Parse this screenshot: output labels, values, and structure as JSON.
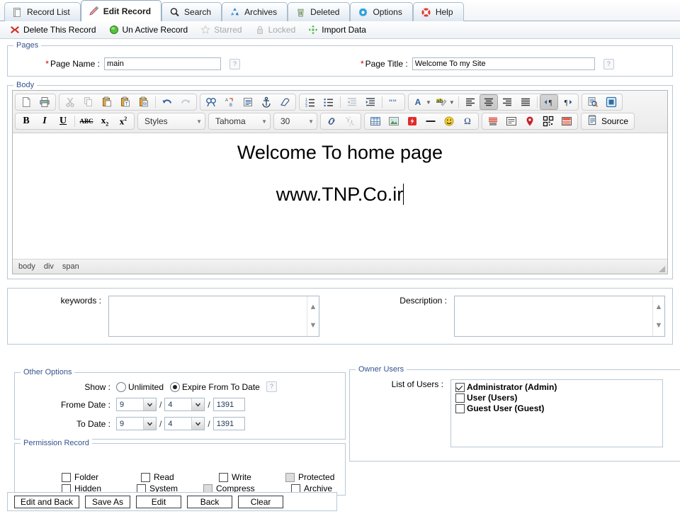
{
  "tabs": [
    {
      "label": "Record List",
      "icon": "document-icon",
      "active": false
    },
    {
      "label": "Edit Record",
      "icon": "pencil-icon",
      "active": true
    },
    {
      "label": "Search",
      "icon": "magnifier-icon",
      "active": false
    },
    {
      "label": "Archives",
      "icon": "recycle-icon",
      "active": false
    },
    {
      "label": "Deleted",
      "icon": "trash-icon",
      "active": false
    },
    {
      "label": "Options",
      "icon": "gear-icon",
      "active": false
    },
    {
      "label": "Help",
      "icon": "lifebuoy-icon",
      "active": false
    }
  ],
  "actions": [
    {
      "label": "Delete This Record",
      "icon": "red-x-icon",
      "enabled": true
    },
    {
      "label": "Un Active Record",
      "icon": "green-circle-icon",
      "enabled": true
    },
    {
      "label": "Starred",
      "icon": "star-icon",
      "enabled": false
    },
    {
      "label": "Locked",
      "icon": "padlock-icon",
      "enabled": false
    },
    {
      "label": "Import Data",
      "icon": "move-arrows-icon",
      "enabled": true
    }
  ],
  "pages": {
    "legend": "Pages",
    "page_name_label": "Page Name :",
    "page_name_value": "main",
    "page_title_label": "Page Title :",
    "page_title_value": "Welcome To my Site",
    "required_marker": "*",
    "help_glyph": "?"
  },
  "body_section": {
    "legend": "Body",
    "toolbar_row1": [
      {
        "group": 1,
        "items": [
          "new-page-icon",
          "print-icon"
        ]
      },
      {
        "group": 2,
        "items": [
          "cut-icon",
          "copy-icon",
          "paste-icon",
          "paste-text-icon",
          "paste-word-icon",
          "sep",
          "undo-icon",
          "redo-icon"
        ]
      },
      {
        "group": 3,
        "items": [
          "find-icon",
          "replace-icon",
          "select-all-icon",
          "anchor-icon",
          "remove-format-icon"
        ]
      },
      {
        "group": 4,
        "items": [
          "numbered-list-icon",
          "bulleted-list-icon",
          "sep",
          "outdent-icon",
          "indent-icon",
          "sep",
          "blockquote-icon"
        ]
      },
      {
        "group": 5,
        "items": [
          "text-color-icon",
          "bg-color-icon",
          "sep",
          "align-left-icon",
          "align-center-icon",
          "align-right-icon",
          "align-justify-icon",
          "sep",
          "ltr-icon",
          "rtl-icon"
        ]
      },
      {
        "group": 6,
        "items": [
          "preview-icon",
          "maximize-icon"
        ]
      }
    ],
    "toolbar_row2": [
      {
        "group": 1,
        "items": [
          "bold-icon",
          "italic-icon",
          "underline-icon",
          "sep",
          "strikethrough-icon",
          "subscript-icon",
          "superscript-icon"
        ]
      },
      {
        "group": 2,
        "items": [
          "link-icon",
          "unlink-icon"
        ]
      },
      {
        "group": 3,
        "items": [
          "table-icon",
          "image-icon",
          "flash-icon",
          "hr-icon",
          "smiley-icon",
          "special-char-icon"
        ]
      },
      {
        "group": 4,
        "items": [
          "div-icon",
          "form-icon",
          "marker-icon",
          "qrcode-icon",
          "template-icon"
        ]
      }
    ],
    "styles_label": "Styles",
    "font_label": "Tahoma",
    "size_label": "30",
    "source_label": "Source",
    "content_line1": "Welcome To home page",
    "content_line2": "www.TNP.Co.ir",
    "elements_path": [
      "body",
      "div",
      "span"
    ]
  },
  "meta": {
    "keywords_label": "keywords :",
    "keywords_value": "",
    "description_label": "Description :",
    "description_value": ""
  },
  "other_options": {
    "legend": "Other Options",
    "show_label": "Show :",
    "radio_unlimited": "Unlimited",
    "radio_expire": "Expire From To Date",
    "selected_radio": "expire",
    "help_glyph": "?",
    "from_date_label": "Frome Date :",
    "to_date_label": "To Date :",
    "from_day": "9",
    "from_month": "4",
    "from_year": "1391",
    "to_day": "9",
    "to_month": "4",
    "to_year": "1391",
    "separator": "/"
  },
  "owner_users": {
    "legend": "Owner Users",
    "list_label": "List of Users :",
    "users": [
      {
        "label": "Administrator (Admin)",
        "checked": true
      },
      {
        "label": "User (Users)",
        "checked": false
      },
      {
        "label": "Guest User (Guest)",
        "checked": false
      }
    ]
  },
  "permission": {
    "legend": "Permission Record",
    "items": [
      {
        "label": "Folder",
        "checked": false,
        "disabled": false
      },
      {
        "label": "Read",
        "checked": false,
        "disabled": false
      },
      {
        "label": "Write",
        "checked": false,
        "disabled": false
      },
      {
        "label": "Protected",
        "checked": false,
        "disabled": true
      },
      {
        "label": "Hidden",
        "checked": false,
        "disabled": false
      },
      {
        "label": "System",
        "checked": false,
        "disabled": false
      },
      {
        "label": "Compress",
        "checked": false,
        "disabled": true
      },
      {
        "label": "Archive",
        "checked": false,
        "disabled": false
      }
    ]
  },
  "footer_buttons": [
    {
      "label": "Edit and Back"
    },
    {
      "label": "Save As"
    },
    {
      "label": "Edit"
    },
    {
      "label": "Back"
    },
    {
      "label": "Clear"
    }
  ],
  "colors": {
    "legend_text": "#34538c",
    "required": "#cc0000",
    "tab_border": "#a8bdd0",
    "field_border": "#a9b9c9"
  }
}
